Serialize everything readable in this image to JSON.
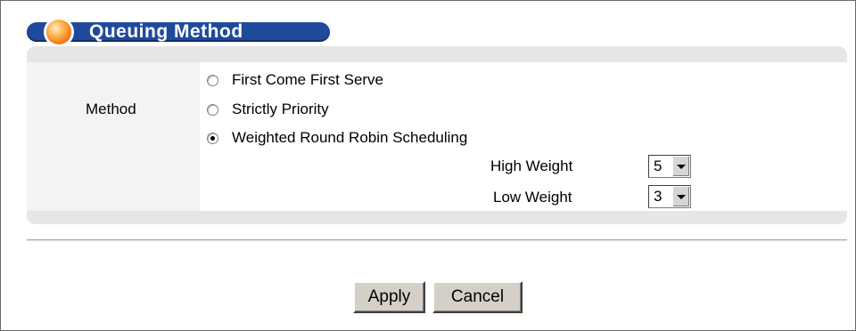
{
  "section": {
    "title": "Queuing Method"
  },
  "form": {
    "method_label": "Method",
    "options": [
      {
        "label": "First Come First Serve",
        "checked": false
      },
      {
        "label": "Strictly Priority",
        "checked": false
      },
      {
        "label": "Weighted Round Robin Scheduling",
        "checked": true
      }
    ],
    "high_weight_label": "High Weight",
    "high_weight_value": "5",
    "low_weight_label": "Low Weight",
    "low_weight_value": "3"
  },
  "buttons": {
    "apply_label": "Apply",
    "cancel_label": "Cancel"
  },
  "colors": {
    "title_bar": "#1f4a9c",
    "panel": "#f3f3f3",
    "button_face": "#d4d0c8"
  }
}
